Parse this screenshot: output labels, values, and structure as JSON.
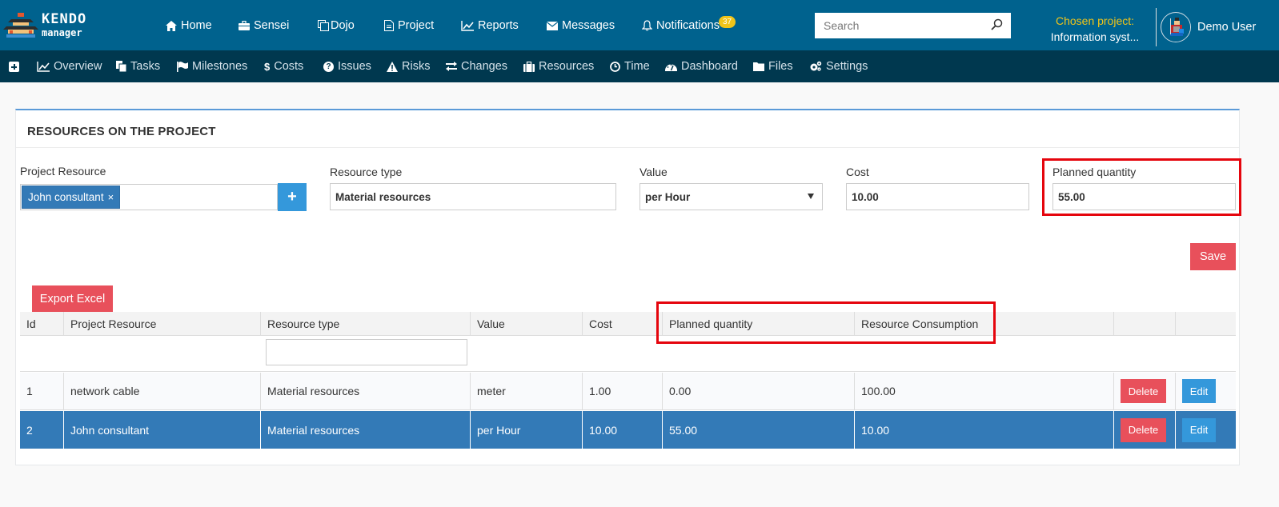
{
  "topbar": {
    "logo": {
      "line1": "KENDO",
      "line2": "manager"
    },
    "nav": [
      {
        "label": "Home",
        "icon": "home-icon",
        "glyph": "⌂"
      },
      {
        "label": "Sensei",
        "icon": "briefcase-icon",
        "glyph": "▤"
      },
      {
        "label": "Dojo",
        "icon": "copy-icon",
        "glyph": "❐"
      },
      {
        "label": "Project",
        "icon": "document-icon",
        "glyph": "▯"
      },
      {
        "label": "Reports",
        "icon": "line-chart-icon",
        "glyph": "⟋"
      },
      {
        "label": "Messages",
        "icon": "envelope-icon",
        "glyph": "✉"
      },
      {
        "label": "Notifications",
        "icon": "bell-icon",
        "glyph": "♪"
      }
    ],
    "notifications_count": "37",
    "search": {
      "placeholder": "Search",
      "value": ""
    },
    "chosen_project": {
      "label": "Chosen project:",
      "value": "Information syst..."
    },
    "user": {
      "name": "Demo User"
    }
  },
  "subnav": [
    {
      "label": "Overview",
      "icon": "line-chart-icon",
      "glyph": "⟋"
    },
    {
      "label": "Tasks",
      "icon": "files-icon",
      "glyph": "❏"
    },
    {
      "label": "Milestones",
      "icon": "flag-icon",
      "glyph": "⚑"
    },
    {
      "label": "Costs",
      "icon": "dollar-icon",
      "glyph": "$"
    },
    {
      "label": "Issues",
      "icon": "question-circle-icon",
      "glyph": "?"
    },
    {
      "label": "Risks",
      "icon": "warning-icon",
      "glyph": "▲"
    },
    {
      "label": "Changes",
      "icon": "exchange-icon",
      "glyph": "⇄"
    },
    {
      "label": "Resources",
      "icon": "suitcase-icon",
      "glyph": "▣"
    },
    {
      "label": "Time",
      "icon": "clock-icon",
      "glyph": "◷"
    },
    {
      "label": "Dashboard",
      "icon": "dashboard-icon",
      "glyph": "◕"
    },
    {
      "label": "Files",
      "icon": "folder-icon",
      "glyph": "▬"
    },
    {
      "label": "Settings",
      "icon": "cogs-icon",
      "glyph": "⚙"
    }
  ],
  "panel": {
    "title": "RESOURCES ON THE PROJECT",
    "form": {
      "project_resource": {
        "label": "Project Resource",
        "tag": "John consultant",
        "remove_glyph": "×",
        "add_glyph": "+"
      },
      "resource_type": {
        "label": "Resource type",
        "value": "Material resources"
      },
      "value": {
        "label": "Value",
        "selected": "per Hour"
      },
      "cost": {
        "label": "Cost",
        "value": "10.00"
      },
      "planned_quantity": {
        "label": "Planned quantity",
        "value": "55.00"
      }
    },
    "save_label": "Save",
    "export_label": "Export Excel",
    "table": {
      "columns": [
        "Id",
        "Project Resource",
        "Resource type",
        "Value",
        "Cost",
        "Planned quantity",
        "Resource Consumption",
        "",
        ""
      ],
      "filter_placeholder": "",
      "rows": [
        {
          "id": "1",
          "resource": "network cable",
          "type": "Material resources",
          "value": "meter",
          "cost": "1.00",
          "planned": "0.00",
          "consumption": "100.00",
          "delete": "Delete",
          "edit": "Edit",
          "selected": false
        },
        {
          "id": "2",
          "resource": "John consultant",
          "type": "Material resources",
          "value": "per Hour",
          "cost": "10.00",
          "planned": "55.00",
          "consumption": "10.00",
          "delete": "Delete",
          "edit": "Edit",
          "selected": true
        }
      ]
    }
  }
}
